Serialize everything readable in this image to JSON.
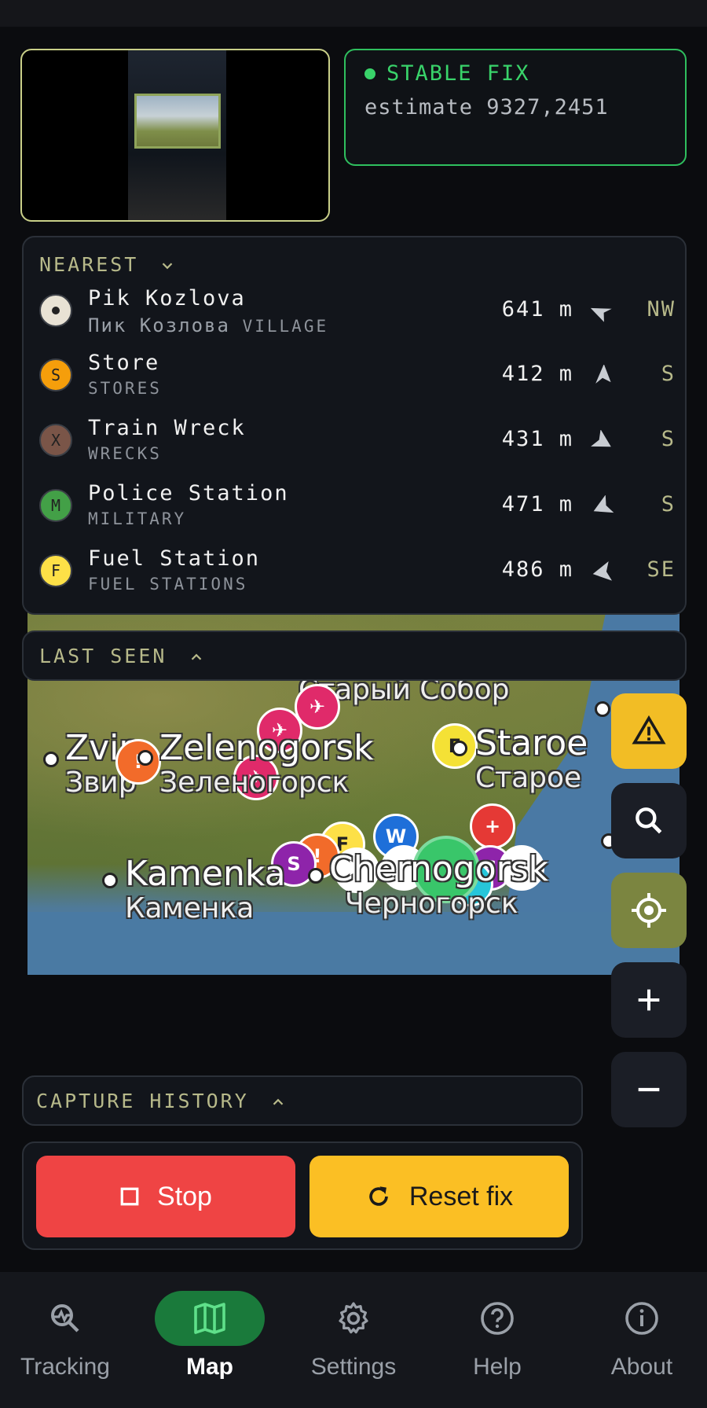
{
  "camera": {
    "label": "camera preview"
  },
  "fix": {
    "status": "STABLE FIX",
    "estimate": "estimate 9327,2451",
    "status_color": "#39d36a"
  },
  "nearest": {
    "header": "NEAREST",
    "items": [
      {
        "name": "Pik Kozlova",
        "name_ru": "Пик Козлова",
        "category": "VILLAGE",
        "distance": "641 m",
        "direction": "NW",
        "icon": "village-dot-icon",
        "icon_letter": "",
        "color": "#e8e2d4"
      },
      {
        "name": "Store",
        "name_ru": "",
        "category": "STORES",
        "distance": "412 m",
        "direction": "S",
        "icon": "store-icon",
        "icon_letter": "S",
        "color": "#f59e0b"
      },
      {
        "name": "Train Wreck",
        "name_ru": "",
        "category": "WRECKS",
        "distance": "431 m",
        "direction": "S",
        "icon": "wreck-icon",
        "icon_letter": "X",
        "color": "#7a5548"
      },
      {
        "name": "Police Station",
        "name_ru": "",
        "category": "MILITARY",
        "distance": "471 m",
        "direction": "S",
        "icon": "military-icon",
        "icon_letter": "M",
        "color": "#43a047"
      },
      {
        "name": "Fuel Station",
        "name_ru": "",
        "category": "FUEL STATIONS",
        "distance": "486 m",
        "direction": "SE",
        "icon": "fuel-icon",
        "icon_letter": "F",
        "color": "#fde047"
      }
    ]
  },
  "last_seen": {
    "header": "LAST SEEN"
  },
  "map": {
    "towns": [
      {
        "en": "Zvir",
        "ru": "Звир"
      },
      {
        "en": "Zelenogorsk",
        "ru": "Зеленогорск"
      },
      {
        "en": "Staroe",
        "ru": "Старое"
      },
      {
        "en": "Kamenka",
        "ru": "Каменка"
      },
      {
        "en": "Chernogorsk",
        "ru": "Черногорск"
      },
      {
        "en": "",
        "ru": "Старый Собор"
      }
    ]
  },
  "capture_history": {
    "header": "CAPTURE HISTORY"
  },
  "actions": {
    "stop": "Stop",
    "reset": "Reset fix"
  },
  "nav": [
    {
      "label": "Tracking",
      "icon": "tracking-icon"
    },
    {
      "label": "Map",
      "icon": "map-icon",
      "active": true
    },
    {
      "label": "Settings",
      "icon": "gear-icon"
    },
    {
      "label": "Help",
      "icon": "help-icon"
    },
    {
      "label": "About",
      "icon": "info-icon"
    }
  ]
}
